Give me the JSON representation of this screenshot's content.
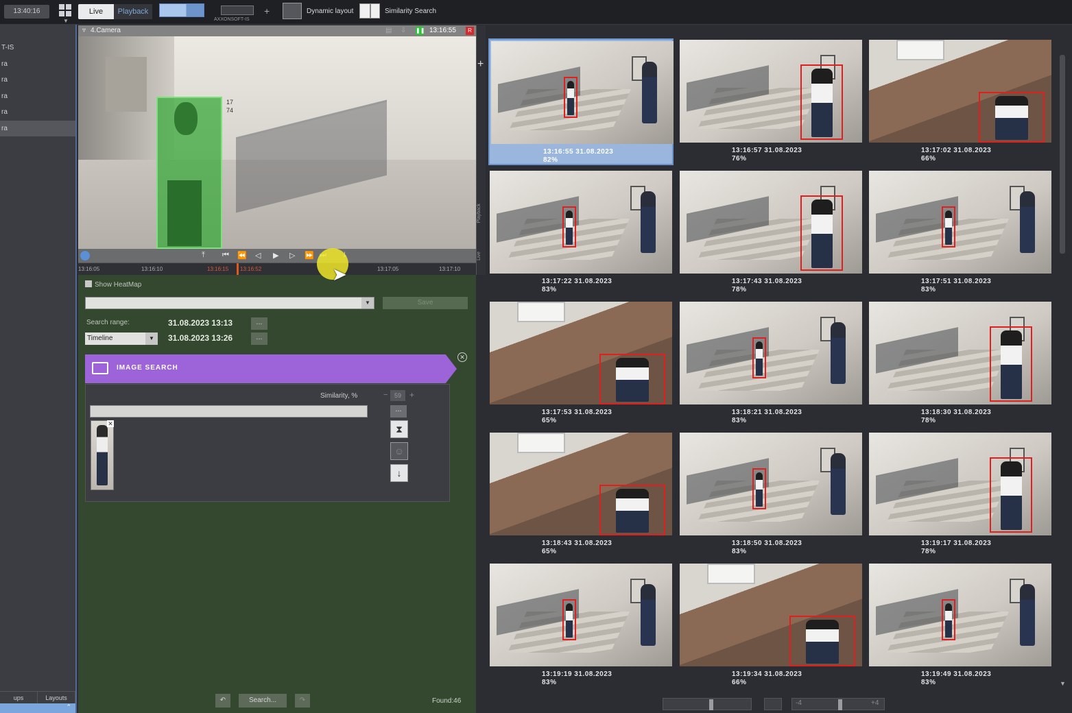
{
  "topbar": {
    "clock": "13:40:16",
    "mode_live": "Live",
    "mode_playback": "Playback",
    "layout_server_label": "AXXONSOFT-IS",
    "dynamic_layout": "Dynamic layout",
    "similarity_search": "Similarity Search"
  },
  "sidebar": {
    "items": [
      "T-IS",
      "ra",
      "ra",
      "ra",
      "ra",
      "ra"
    ],
    "tab_left": "ups",
    "tab_layouts": "Layouts"
  },
  "camera": {
    "title": "4.Camera",
    "time": "13:16:55",
    "rec_badge": "R",
    "box_nums": [
      "17",
      "74"
    ],
    "timeline_ticks": [
      "13:16:05",
      "13:16:10",
      "13:16:15",
      "13:16:52",
      "13:17:05",
      "13:17:10"
    ],
    "side_labels": [
      "Playback",
      "Live"
    ]
  },
  "search_panel": {
    "show_heatmap": "Show HeatMap",
    "save": "Save",
    "search_range_label": "Search range:",
    "range_mode": "Timeline",
    "date_from": "31.08.2023  13:13",
    "date_to": "31.08.2023  13:26",
    "dots": "...",
    "image_search_title": "IMAGE SEARCH",
    "similarity_label": "Similarity, %",
    "similarity_value": "59",
    "search_button": "Search...",
    "found": "Found:46"
  },
  "results": [
    {
      "time": "13:16:55 31.08.2023",
      "score": "82%",
      "selected": true
    },
    {
      "time": "13:16:57 31.08.2023",
      "score": "76%"
    },
    {
      "time": "13:17:02 31.08.2023",
      "score": "66%"
    },
    {
      "time": "13:17:22 31.08.2023",
      "score": "83%"
    },
    {
      "time": "13:17:43 31.08.2023",
      "score": "78%"
    },
    {
      "time": "13:17:51 31.08.2023",
      "score": "83%"
    },
    {
      "time": "13:17:53 31.08.2023",
      "score": "65%"
    },
    {
      "time": "13:18:21 31.08.2023",
      "score": "83%"
    },
    {
      "time": "13:18:30 31.08.2023",
      "score": "78%"
    },
    {
      "time": "13:18:43 31.08.2023",
      "score": "65%"
    },
    {
      "time": "13:18:50 31.08.2023",
      "score": "83%"
    },
    {
      "time": "13:19:17 31.08.2023",
      "score": "78%"
    },
    {
      "time": "13:19:19 31.08.2023",
      "score": "83%"
    },
    {
      "time": "13:19:34 31.08.2023",
      "score": "66%"
    },
    {
      "time": "13:19:49 31.08.2023",
      "score": "83%"
    }
  ],
  "zoom_bar": {
    "minus_label": "-4",
    "plus_label": "+4"
  },
  "colors": {
    "accent_purple": "#9d63d8",
    "detection_red": "#e01f1f",
    "selection_blue": "#9bb6dc",
    "search_panel_green": "#33482f"
  }
}
